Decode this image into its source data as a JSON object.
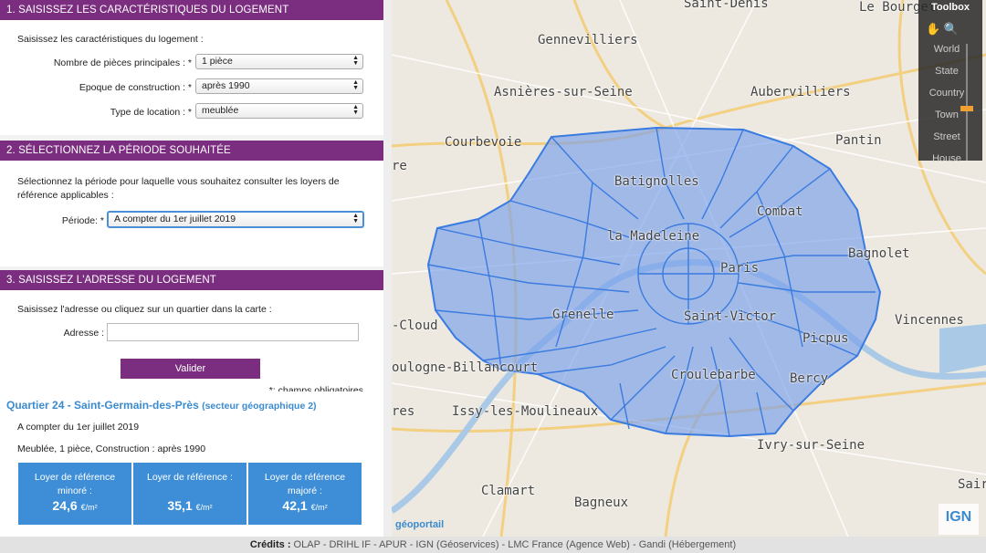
{
  "section1": {
    "header": "1. SAISISSEZ LES CARACTÉRISTIQUES DU LOGEMENT",
    "intro": "Saisissez les caractéristiques du logement :",
    "fields": [
      {
        "label": "Nombre de pièces principales : *",
        "value": "1 pièce"
      },
      {
        "label": "Epoque de construction : *",
        "value": "après 1990"
      },
      {
        "label": "Type de location : *",
        "value": "meublée"
      }
    ]
  },
  "section2": {
    "header": "2. SÉLECTIONNEZ LA PÉRIODE SOUHAITÉE",
    "intro_line1": "Sélectionnez la période pour laquelle vous souhaitez consulter les loyers de",
    "intro_line2": "référence applicables :",
    "period_label": "Période: *",
    "period_value": "A compter du 1er juillet 2019"
  },
  "section3": {
    "header": "3. SAISISSEZ L'ADRESSE DU LOGEMENT",
    "intro": "Saisissez l'adresse ou cliquez sur un quartier dans la carte :",
    "address_label": "Adresse :",
    "address_value": "",
    "submit_label": "Valider",
    "required_note": "*: champs obligatoires"
  },
  "result": {
    "title": "Quartier 24 - Saint-Germain-des-Près",
    "subtitle": "(secteur géographique 2)",
    "period": "A compter du 1er juillet 2019",
    "description": "Meublée, 1 pièce, Construction : après 1990",
    "cards": [
      {
        "line1": "Loyer de référence",
        "line2": "minoré :",
        "value": "24,6",
        "unit": "€/m²"
      },
      {
        "line1": "Loyer de référence :",
        "line2": "",
        "value": "35,1",
        "unit": "€/m²"
      },
      {
        "line1": "Loyer de référence",
        "line2": "majoré :",
        "value": "42,1",
        "unit": "€/m²"
      }
    ]
  },
  "map": {
    "labels": [
      {
        "text": "Saint-Denis",
        "cls": ""
      },
      {
        "text": "Le Bourget",
        "cls": ""
      },
      {
        "text": "Gennevilliers",
        "cls": ""
      },
      {
        "text": "Asnières-sur-Seine",
        "cls": ""
      },
      {
        "text": "Aubervilliers",
        "cls": ""
      },
      {
        "text": "Courbevoie",
        "cls": ""
      },
      {
        "text": "Pantin",
        "cls": ""
      },
      {
        "text": "Batignolles",
        "cls": ""
      },
      {
        "text": "Combat",
        "cls": ""
      },
      {
        "text": "la Madeleine",
        "cls": ""
      },
      {
        "text": "Bagnolet",
        "cls": ""
      },
      {
        "text": "Paris",
        "cls": ""
      },
      {
        "text": "Grenelle",
        "cls": ""
      },
      {
        "text": "Saint-Victor",
        "cls": ""
      },
      {
        "text": "Vincennes",
        "cls": ""
      },
      {
        "text": "-Cloud",
        "cls": ""
      },
      {
        "text": "Picpus",
        "cls": ""
      },
      {
        "text": "oulogne-Billancourt",
        "cls": ""
      },
      {
        "text": "Croulebarbe",
        "cls": ""
      },
      {
        "text": "Bercy",
        "cls": ""
      },
      {
        "text": "Issy-les-Moulineaux",
        "cls": ""
      },
      {
        "text": "Ivry-sur-Seine",
        "cls": ""
      },
      {
        "text": "Clamart",
        "cls": ""
      },
      {
        "text": "Bagneux",
        "cls": ""
      },
      {
        "text": "re",
        "cls": ""
      },
      {
        "text": "res",
        "cls": ""
      },
      {
        "text": "Sair",
        "cls": ""
      }
    ],
    "geoportail": "géoportail",
    "ign": "IGN"
  },
  "toolbox": {
    "title": "Toolbox",
    "levels": [
      "World",
      "State",
      "Country",
      "Town",
      "Street",
      "House"
    ],
    "level_value": 0.55
  },
  "footer": {
    "credits_label": "Crédits :",
    "credits": " OLAP - DRIHL IF - APUR - IGN (Géoservices) - LMC France (Agence Web) - Gandi (Hébergement)"
  }
}
